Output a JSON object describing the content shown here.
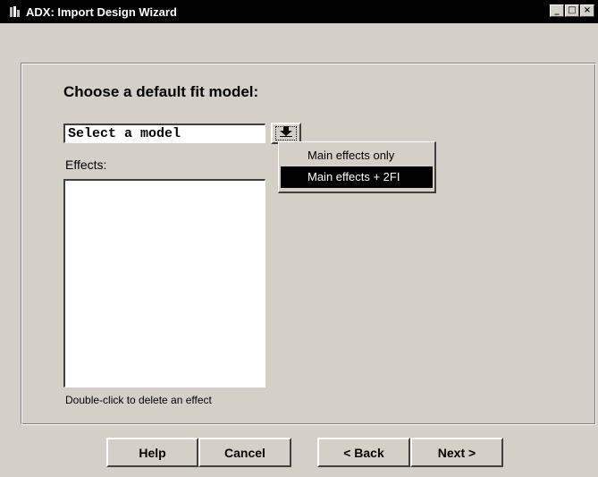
{
  "window": {
    "title": "ADX: Import Design Wizard",
    "controls": {
      "minimize": "_",
      "maximize": "□",
      "close": "×"
    }
  },
  "main": {
    "heading": "Choose a default fit model:",
    "model_select": {
      "value": "Select a model",
      "options": [
        "Main effects only",
        "Main effects + 2FI"
      ],
      "highlighted_option": "Main effects + 2FI"
    },
    "effects_label": "Effects:",
    "effects_list": [],
    "hint": "Double-click to delete an effect"
  },
  "buttons": {
    "help": "Help",
    "cancel": "Cancel",
    "back": "< Back",
    "next": "Next >"
  },
  "icons": {
    "app": "app-icon",
    "dropdown": "arrow-down-icon"
  }
}
